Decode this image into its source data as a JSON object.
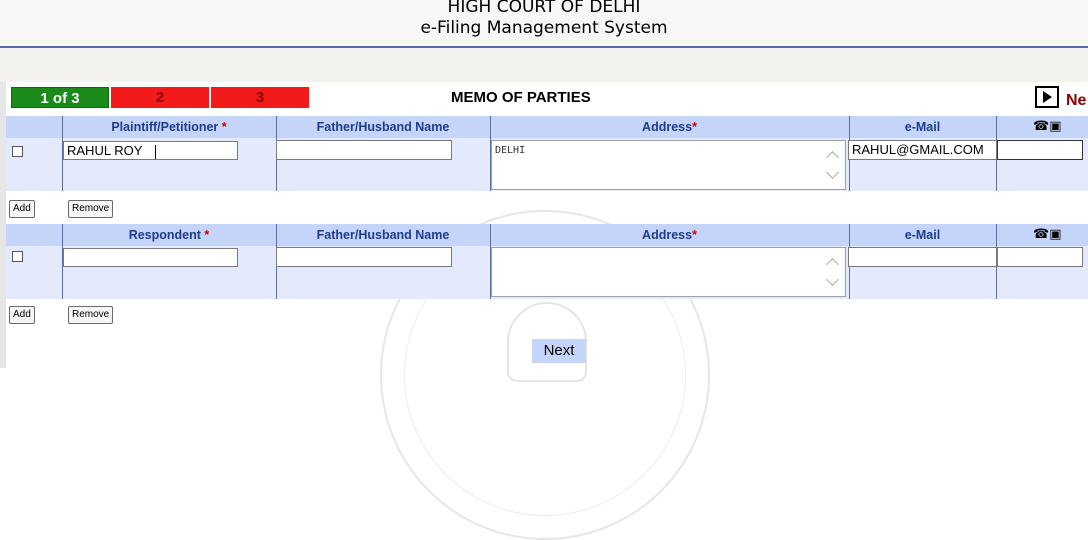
{
  "header": {
    "line1": "HIGH COURT OF DELHI",
    "line2": "e-Filing Management System"
  },
  "steps": [
    {
      "label": "1 of 3",
      "status": "current",
      "color": "#1b8a1b"
    },
    {
      "label": "2",
      "status": "pending",
      "color": "#f21a1a"
    },
    {
      "label": "3",
      "status": "pending",
      "color": "#f21a1a"
    }
  ],
  "page_title": "MEMO OF PARTIES",
  "nav": {
    "next_icon": "play-arrow-icon",
    "partial_text": "Ne"
  },
  "petitioner_table": {
    "columns": {
      "party": "Plaintiff/Petitioner",
      "father": "Father/Husband Name",
      "address": "Address",
      "email": "e-Mail",
      "contact_icons": "phone-and-mobile-icon"
    },
    "required_marker": "*",
    "row": {
      "name": "RAHUL ROY",
      "father": "",
      "address": "DELHI",
      "email": "RAHUL@GMAIL.COM",
      "phone": ""
    },
    "add_label": "Add",
    "remove_label": "Remove"
  },
  "respondent_table": {
    "columns": {
      "party": "Respondent",
      "father": "Father/Husband Name",
      "address": "Address",
      "email": "e-Mail",
      "contact_icons": "phone-and-mobile-icon"
    },
    "required_marker": "*",
    "row": {
      "name": "",
      "father": "",
      "address": "",
      "email": "",
      "phone": ""
    },
    "add_label": "Add",
    "remove_label": "Remove"
  },
  "next_label": "Next",
  "colors": {
    "header_row": "#c5d5fa",
    "body_row": "#e4e9fb",
    "header_text": "#1f3c8c",
    "required": "#d00000"
  }
}
